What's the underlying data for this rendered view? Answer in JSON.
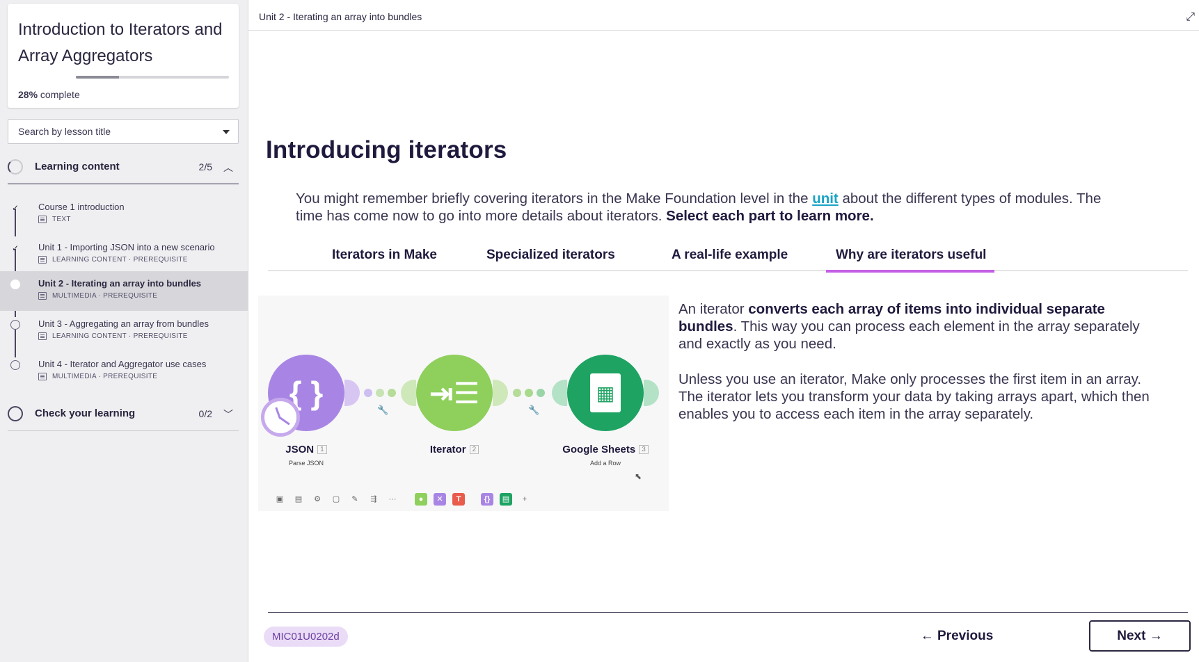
{
  "sidebar": {
    "course_title": "Introduction to Iterators and Array Aggregators",
    "progress_percent": 28,
    "progress_label": "28%",
    "progress_suffix": "complete",
    "search_placeholder": "Search by lesson title",
    "sections": [
      {
        "title": "Learning content",
        "count": "2/5",
        "expanded": true,
        "lessons": [
          {
            "name": "Course 1 introduction",
            "meta": "TEXT",
            "done": true
          },
          {
            "name": "Unit 1 - Importing JSON into a new scenario",
            "meta": "LEARNING CONTENT · PREREQUISITE",
            "done": true
          },
          {
            "name": "Unit 2 - Iterating an array into bundles",
            "meta": "MULTIMEDIA · PREREQUISITE",
            "done": false,
            "active": true
          },
          {
            "name": "Unit 3 - Aggregating an array from bundles",
            "meta": "LEARNING CONTENT · PREREQUISITE",
            "done": false
          },
          {
            "name": "Unit 4 - Iterator and Aggregator use cases",
            "meta": "MULTIMEDIA · PREREQUISITE",
            "done": false
          }
        ]
      },
      {
        "title": "Check your learning",
        "count": "0/2",
        "expanded": false
      }
    ]
  },
  "main": {
    "breadcrumb": "Unit 2 - Iterating an array into bundles",
    "heading": "Introducing iterators",
    "intro_part1": "You might remember briefly covering iterators in the Make Foundation level in the ",
    "intro_link": "unit",
    "intro_part2": " about the different types of modules. The time has come now to go into more details about iterators. ",
    "intro_bold": "Select each part to learn more.",
    "tabs": [
      {
        "label": "Iterators in Make",
        "active": false
      },
      {
        "label": "Specialized iterators",
        "active": false
      },
      {
        "label": "A real-life example",
        "active": false
      },
      {
        "label": "Why are iterators useful",
        "active": true
      }
    ],
    "figure": {
      "modules": [
        {
          "name": "JSON",
          "num": "1",
          "sub": "Parse JSON",
          "color": "#a885e4",
          "glyph": "{ }"
        },
        {
          "name": "Iterator",
          "num": "2",
          "sub": "",
          "color": "#8fcf5c",
          "glyph": "⇥☰"
        },
        {
          "name": "Google Sheets",
          "num": "3",
          "sub": "Add a Row",
          "color": "#1ea362",
          "glyph": "▦"
        }
      ]
    },
    "para1_part1": "An iterator ",
    "para1_bold": "converts each array of items into individual separate bundles",
    "para1_part2": ". This way you can process each element in the array separately and exactly as you need.",
    "para2": "Unless you use an iterator, Make only processes the first item in an array. The iterator lets you transform your data by taking arrays apart, which then enables you to access each item in the array separately.",
    "lesson_code": "MIC01U0202d",
    "prev_label": "← Previous",
    "next_label": "Next →"
  }
}
